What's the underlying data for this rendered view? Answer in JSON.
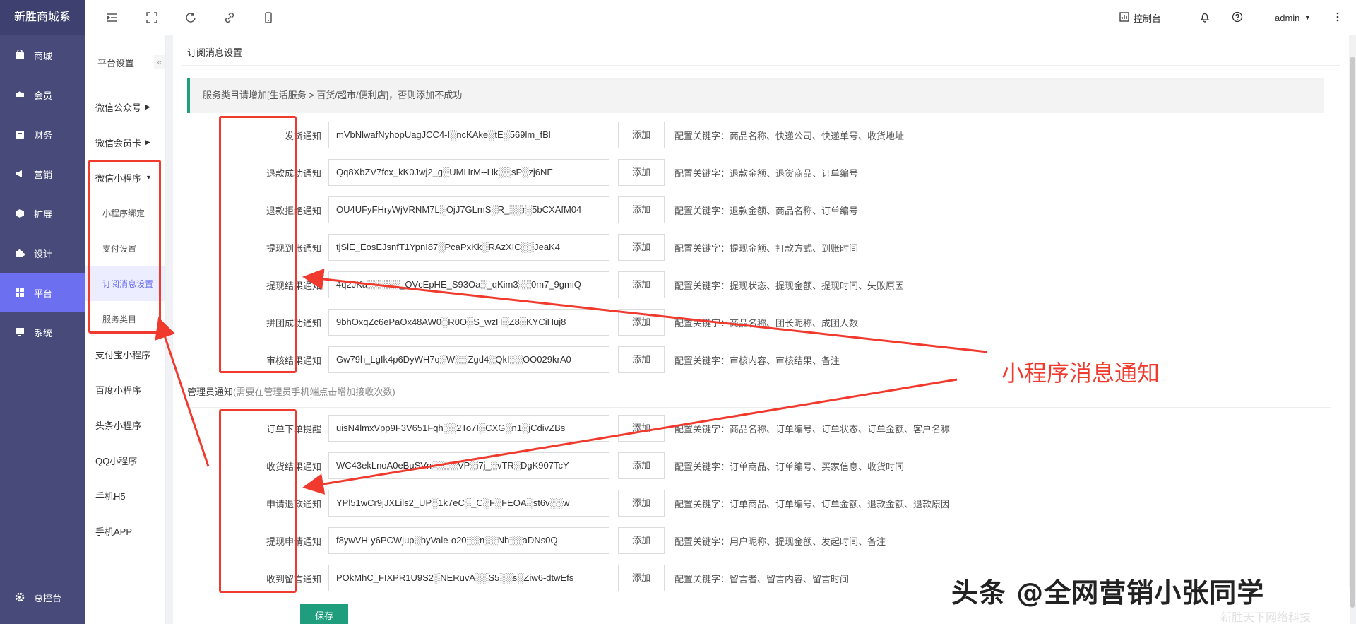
{
  "brand": "新胜商城系",
  "sidebar": {
    "items": [
      {
        "label": "商城",
        "icon": "shop-icon"
      },
      {
        "label": "会员",
        "icon": "member-icon"
      },
      {
        "label": "财务",
        "icon": "finance-icon"
      },
      {
        "label": "营销",
        "icon": "megaphone-icon"
      },
      {
        "label": "扩展",
        "icon": "cube-icon"
      },
      {
        "label": "设计",
        "icon": "puzzle-icon"
      },
      {
        "label": "平台",
        "icon": "grid-icon"
      },
      {
        "label": "系统",
        "icon": "monitor-icon"
      }
    ],
    "bottom": {
      "label": "总控台",
      "icon": "gear-icon"
    }
  },
  "topbar": {
    "console_label": "控制台",
    "user": "admin"
  },
  "submenu": {
    "title": "平台设置",
    "items": {
      "wechat_public": "微信公众号",
      "wechat_card": "微信会员卡",
      "mini_program": "微信小程序",
      "alipay": "支付宝小程序",
      "baidu": "百度小程序",
      "toutiao": "头条小程序",
      "qq": "QQ小程序",
      "h5": "手机H5",
      "app": "手机APP"
    },
    "children": [
      "小程序绑定",
      "支付设置",
      "订阅消息设置",
      "服务类目"
    ]
  },
  "main": {
    "title": "订阅消息设置",
    "notice": "服务类目请增加[生活服务 > 百货/超市/便利店]，否则添加不成功",
    "add_label": "添加",
    "user_rows": [
      {
        "label": "发货通知",
        "value": "mVbNlwafNyhopUagJCC4-I░ncKAke░tE░569lm_fBl",
        "keywords": "配置关键字：商品名称、快递公司、快递单号、收货地址"
      },
      {
        "label": "退款成功通知",
        "value": "Qq8XbZV7fcx_kK0Jwj2_g░UMHrM--Hk░░sP░zj6NE",
        "keywords": "配置关键字：退款金额、退货商品、订单编号"
      },
      {
        "label": "退款拒绝通知",
        "value": "OU4UFyFHryWjVRNM7L░OjJ7GLmS░R_░░r░5bCXAfM04",
        "keywords": "配置关键字：退款金额、商品名称、订单编号"
      },
      {
        "label": "提现到账通知",
        "value": "tjSlE_EosEJsnfT1YpnI87░PcaPxKk░RAzXIC░░JeaK4",
        "keywords": "配置关键字：提现金额、打款方式、到账时间"
      },
      {
        "label": "提现结果通知",
        "value": "4q2JKa░░░░░_OVcEpHE_S93Oa░_qKim3░░0m7_9gmiQ",
        "keywords": "配置关键字：提现状态、提现金额、提现时间、失败原因"
      },
      {
        "label": "拼团成功通知",
        "value": "9bhOxqZc6ePaOx48AW0░R0O░S_wzH░Z8░KYCiHuj8",
        "keywords": "配置关键字：商品名称、团长昵称、成团人数"
      },
      {
        "label": "审核结果通知",
        "value": "Gw79h_LgIk4p6DyWH7q░W░░Zgd4░QkI░░OO029krA0",
        "keywords": "配置关键字：审核内容、审核结果、备注"
      }
    ],
    "admin_section": {
      "title": "管理员通知",
      "hint": "(需要在管理员手机端点击增加接收次数)"
    },
    "admin_rows": [
      {
        "label": "订单下单提醒",
        "value": "uisN4lmxVpp9F3V651Fqh░░2To7I░CXG░n1░jCdivZBs",
        "keywords": "配置关键字：商品名称、订单编号、订单状态、订单金额、客户名称"
      },
      {
        "label": "收货结果通知",
        "value": "WC43ekLnoA0eBuSVn░░░░VP░i7j_░vTR░DgK907TcY",
        "keywords": "配置关键字：订单商品、订单编号、买家信息、收货时间"
      },
      {
        "label": "申请退款通知",
        "value": "YPl51wCr9jJXLils2_UP░1k7eC░_C░F░FEOA░st6v░░w",
        "keywords": "配置关键字：订单商品、订单编号、订单金额、退款金额、退款原因"
      },
      {
        "label": "提现申请通知",
        "value": "f8ywVH-y6PCWjup░byVale-o20░░n░░Nh░░aDNs0Q",
        "keywords": "配置关键字：用户昵称、提现金额、发起时间、备注"
      },
      {
        "label": "收到留言通知",
        "value": "POkMhC_FIXPR1U9S2░NERuvA░░S5░░s░Ziw6-dtwEfs",
        "keywords": "配置关键字：留言者、留言内容、留言时间"
      }
    ],
    "save_label": "保存"
  },
  "annotation": {
    "label": "小程序消息通知",
    "color": "#f03a2e"
  },
  "watermark": {
    "text": "头条 @全网营销小张同学",
    "sub": "新胜天下网络科技"
  }
}
